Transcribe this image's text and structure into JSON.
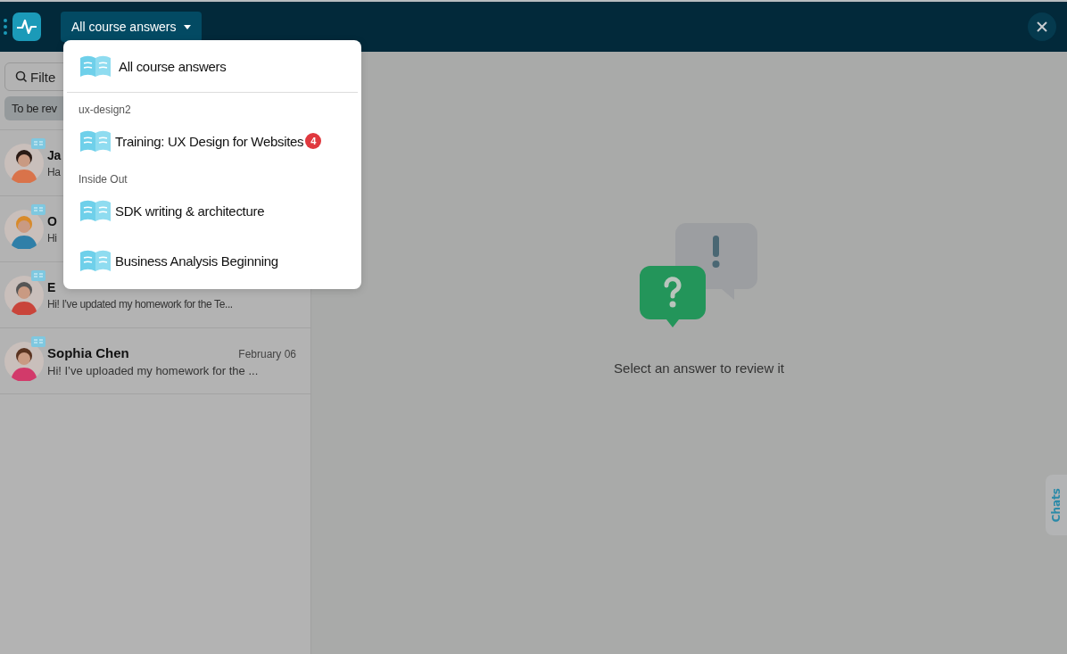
{
  "topbar": {
    "course_select": "All course answers"
  },
  "sidebar": {
    "filter": {
      "placeholder": "Filte"
    },
    "chip": "To be rev",
    "rows": [
      {
        "name": "Ja",
        "preview": "Ha",
        "date": ""
      },
      {
        "name": "O",
        "preview": "Hi",
        "date": ""
      },
      {
        "name": "E",
        "preview": "Hi! I’ve updated my homework for the Te...",
        "date": ""
      },
      {
        "name": "Sophia Chen",
        "preview": "Hi! I’ve uploaded my homework for the ...",
        "date": "February 06"
      }
    ]
  },
  "dropdown": {
    "items": [
      {
        "kind": "course",
        "label": "All course answers"
      },
      {
        "kind": "divider"
      },
      {
        "kind": "group",
        "label": "ux-design2"
      },
      {
        "kind": "course",
        "label": "Training: UX Design for Websites",
        "badge": "4"
      },
      {
        "kind": "group",
        "label": "Inside Out"
      },
      {
        "kind": "course",
        "label": "SDK writing & architecture"
      },
      {
        "kind": "course",
        "label": "Business Analysis Beginning"
      }
    ]
  },
  "empty_state": {
    "message": "Select an answer to review it"
  },
  "side_tab": "Chats"
}
